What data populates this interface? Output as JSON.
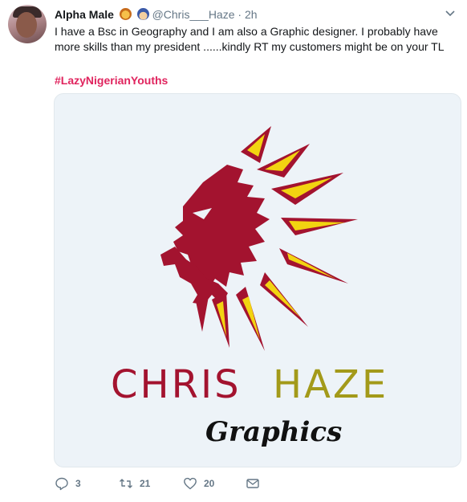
{
  "tweet": {
    "author_name": "Alpha Male",
    "author_emojis": [
      "lion-face-emoji",
      "police-officer-emoji"
    ],
    "handle": "@Chris___Haze",
    "separator": "·",
    "time": "2h",
    "text": "I have a Bsc in Geography and I am also a Graphic designer. I probably have more skills than my president ......kindly RT my customers might be on your TL",
    "hashtag": "#LazyNigerianYouths",
    "media": {
      "brand_word_1": "CHRIS",
      "brand_word_2": "HAZE",
      "tagline": "Graphics",
      "colors": {
        "crimson": "#a3132f",
        "yellow": "#f2d411",
        "olive": "#a39a1a",
        "background": "#edf3f8"
      }
    },
    "actions": {
      "reply_count": "3",
      "retweet_count": "21",
      "like_count": "20"
    }
  },
  "colors": {
    "hashtag": "#e0245e",
    "muted": "#657786"
  }
}
